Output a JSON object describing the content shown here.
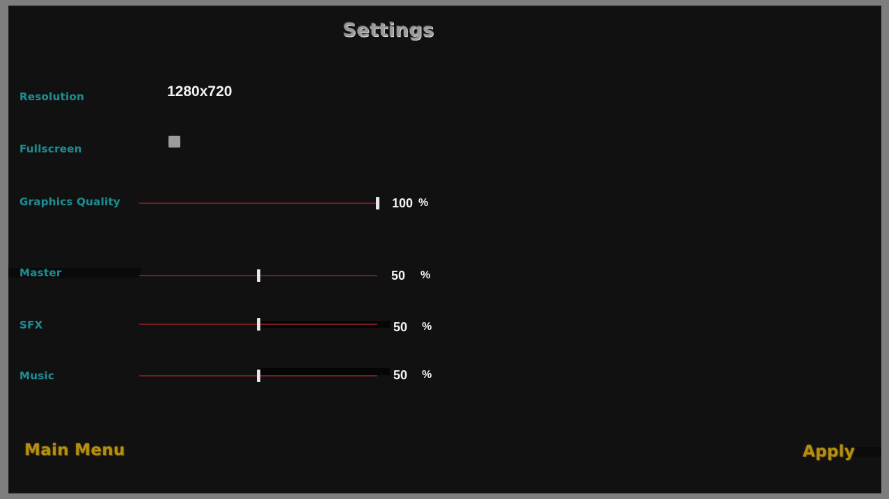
{
  "title": "Settings",
  "resolution": {
    "label": "Resolution",
    "value": "1280x720"
  },
  "fullscreen": {
    "label": "Fullscreen",
    "checked": false
  },
  "graphics_quality": {
    "label": "Graphics Quality",
    "value": "100",
    "unit": "%",
    "fraction": 1.0
  },
  "master": {
    "label": "Master",
    "value": "50",
    "unit": "%",
    "fraction": 0.5
  },
  "sfx": {
    "label": "SFX",
    "value": "50",
    "unit": "%",
    "fraction": 0.5
  },
  "music": {
    "label": "Music",
    "value": "50",
    "unit": "%",
    "fraction": 0.5
  },
  "buttons": {
    "main_menu": "Main Menu",
    "apply": "Apply"
  },
  "colors": {
    "label": "#1f8a8f",
    "button": "#b58f12",
    "slider_track": "#7a1a22",
    "background": "#111111"
  }
}
